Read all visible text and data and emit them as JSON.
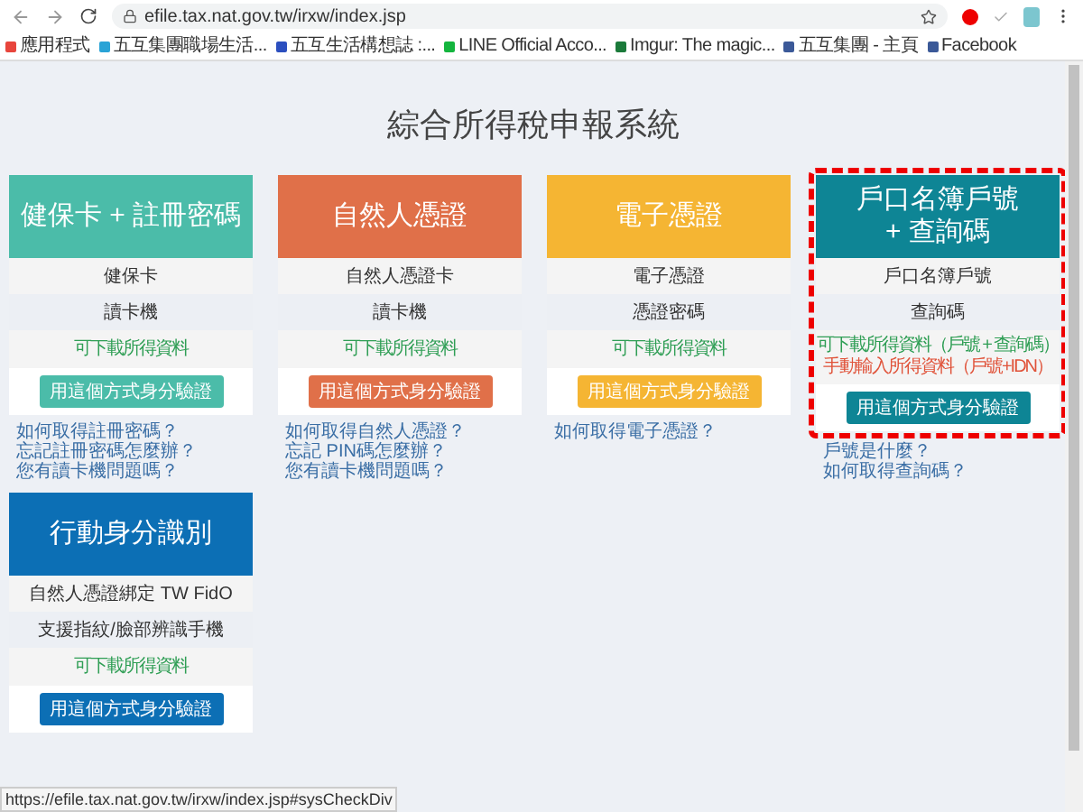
{
  "browser": {
    "url": "efile.tax.nat.gov.tw/irxw/index.jsp",
    "bookmarks": [
      {
        "label": "應用程式",
        "color": "#e8453c"
      },
      {
        "label": "五互集團職場生活...",
        "color": "#29a3d6"
      },
      {
        "label": "五互生活構想誌 :...",
        "color": "#2c4fbf"
      },
      {
        "label": "LINE Official Acco...",
        "color": "#14b53e"
      },
      {
        "label": "Imgur: The magic...",
        "color": "#1b7a3a"
      },
      {
        "label": "五互集團 - 主頁",
        "color": "#3b5998"
      },
      {
        "label": "Facebook",
        "color": "#3b5998"
      }
    ]
  },
  "page": {
    "title": "綜合所得稅申報系統"
  },
  "cards": [
    {
      "title": "健保卡 + 註冊密碼",
      "color": "#4bbca9",
      "highlighted": false,
      "rows": [
        "健保卡",
        "讀卡機"
      ],
      "notes": [
        {
          "text": "可下載所得資料",
          "kind": "download"
        }
      ],
      "button": "用這個方式身分驗證",
      "links": [
        "如何取得註冊密碼？",
        "忘記註冊密碼怎麼辦？",
        "您有讀卡機問題嗎？"
      ]
    },
    {
      "title": "自然人憑證",
      "color": "#e07049",
      "highlighted": false,
      "rows": [
        "自然人憑證卡",
        "讀卡機"
      ],
      "notes": [
        {
          "text": "可下載所得資料",
          "kind": "download"
        }
      ],
      "button": "用這個方式身分驗證",
      "links": [
        "如何取得自然人憑證？",
        "忘記 PIN碼怎麼辦？",
        "您有讀卡機問題嗎？"
      ]
    },
    {
      "title": "電子憑證",
      "color": "#f5b533",
      "highlighted": false,
      "rows": [
        "電子憑證",
        "憑證密碼"
      ],
      "notes": [
        {
          "text": "可下載所得資料",
          "kind": "download"
        }
      ],
      "button": "用這個方式身分驗證",
      "links": [
        "如何取得電子憑證？"
      ]
    },
    {
      "title": "戶口名簿戶號\n+ 查詢碼",
      "color": "#0e8595",
      "highlighted": true,
      "rows": [
        "戶口名簿戶號",
        "查詢碼"
      ],
      "notes": [
        {
          "text": "可下載所得資料（戶號 + 查詢碼）",
          "kind": "download"
        },
        {
          "text": "手動輸入所得資料（戶號+IDN）",
          "kind": "manual"
        }
      ],
      "button": "用這個方式身分驗證",
      "links": [
        "戶號是什麼？",
        "如何取得查詢碼？"
      ]
    },
    {
      "title": "行動身分識別",
      "color": "#0c6fb5",
      "highlighted": false,
      "rows": [
        "自然人憑證綁定 TW FidO",
        "支援指紋/臉部辨識手機"
      ],
      "notes": [
        {
          "text": "可下載所得資料",
          "kind": "download"
        }
      ],
      "button": "用這個方式身分驗證"
    }
  ],
  "status_bar": {
    "text": "https://efile.tax.nat.gov.tw/irxw/index.jsp#sysCheckDiv"
  }
}
